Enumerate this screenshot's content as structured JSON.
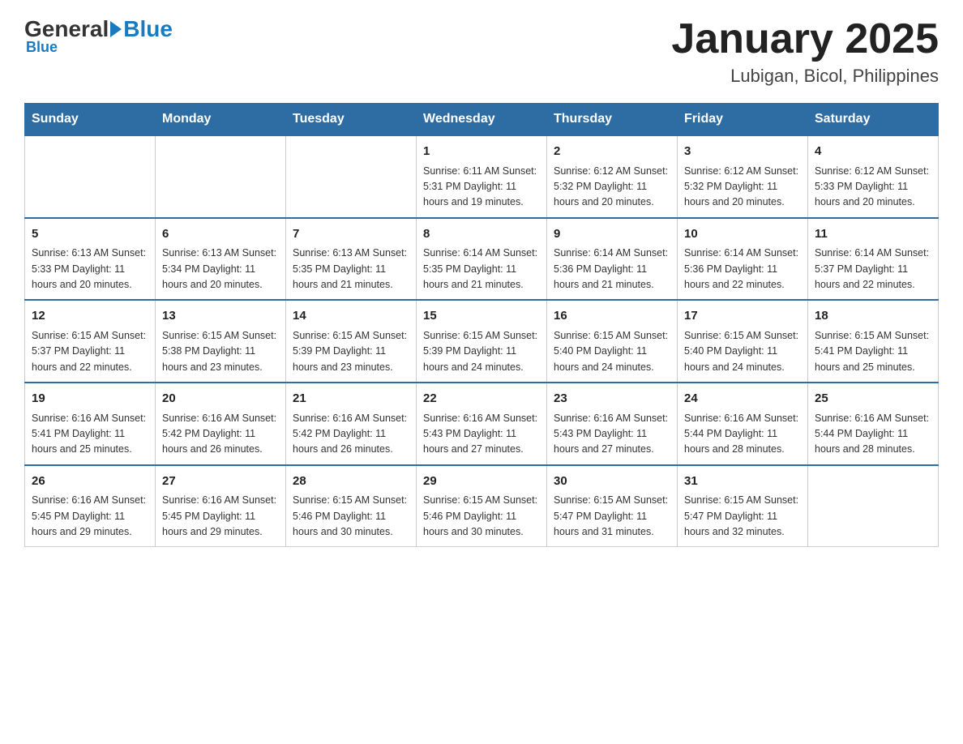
{
  "header": {
    "logo_general": "General",
    "logo_blue": "Blue",
    "month_title": "January 2025",
    "location": "Lubigan, Bicol, Philippines"
  },
  "days_of_week": [
    "Sunday",
    "Monday",
    "Tuesday",
    "Wednesday",
    "Thursday",
    "Friday",
    "Saturday"
  ],
  "weeks": [
    [
      {
        "day": "",
        "info": ""
      },
      {
        "day": "",
        "info": ""
      },
      {
        "day": "",
        "info": ""
      },
      {
        "day": "1",
        "info": "Sunrise: 6:11 AM\nSunset: 5:31 PM\nDaylight: 11 hours\nand 19 minutes."
      },
      {
        "day": "2",
        "info": "Sunrise: 6:12 AM\nSunset: 5:32 PM\nDaylight: 11 hours\nand 20 minutes."
      },
      {
        "day": "3",
        "info": "Sunrise: 6:12 AM\nSunset: 5:32 PM\nDaylight: 11 hours\nand 20 minutes."
      },
      {
        "day": "4",
        "info": "Sunrise: 6:12 AM\nSunset: 5:33 PM\nDaylight: 11 hours\nand 20 minutes."
      }
    ],
    [
      {
        "day": "5",
        "info": "Sunrise: 6:13 AM\nSunset: 5:33 PM\nDaylight: 11 hours\nand 20 minutes."
      },
      {
        "day": "6",
        "info": "Sunrise: 6:13 AM\nSunset: 5:34 PM\nDaylight: 11 hours\nand 20 minutes."
      },
      {
        "day": "7",
        "info": "Sunrise: 6:13 AM\nSunset: 5:35 PM\nDaylight: 11 hours\nand 21 minutes."
      },
      {
        "day": "8",
        "info": "Sunrise: 6:14 AM\nSunset: 5:35 PM\nDaylight: 11 hours\nand 21 minutes."
      },
      {
        "day": "9",
        "info": "Sunrise: 6:14 AM\nSunset: 5:36 PM\nDaylight: 11 hours\nand 21 minutes."
      },
      {
        "day": "10",
        "info": "Sunrise: 6:14 AM\nSunset: 5:36 PM\nDaylight: 11 hours\nand 22 minutes."
      },
      {
        "day": "11",
        "info": "Sunrise: 6:14 AM\nSunset: 5:37 PM\nDaylight: 11 hours\nand 22 minutes."
      }
    ],
    [
      {
        "day": "12",
        "info": "Sunrise: 6:15 AM\nSunset: 5:37 PM\nDaylight: 11 hours\nand 22 minutes."
      },
      {
        "day": "13",
        "info": "Sunrise: 6:15 AM\nSunset: 5:38 PM\nDaylight: 11 hours\nand 23 minutes."
      },
      {
        "day": "14",
        "info": "Sunrise: 6:15 AM\nSunset: 5:39 PM\nDaylight: 11 hours\nand 23 minutes."
      },
      {
        "day": "15",
        "info": "Sunrise: 6:15 AM\nSunset: 5:39 PM\nDaylight: 11 hours\nand 24 minutes."
      },
      {
        "day": "16",
        "info": "Sunrise: 6:15 AM\nSunset: 5:40 PM\nDaylight: 11 hours\nand 24 minutes."
      },
      {
        "day": "17",
        "info": "Sunrise: 6:15 AM\nSunset: 5:40 PM\nDaylight: 11 hours\nand 24 minutes."
      },
      {
        "day": "18",
        "info": "Sunrise: 6:15 AM\nSunset: 5:41 PM\nDaylight: 11 hours\nand 25 minutes."
      }
    ],
    [
      {
        "day": "19",
        "info": "Sunrise: 6:16 AM\nSunset: 5:41 PM\nDaylight: 11 hours\nand 25 minutes."
      },
      {
        "day": "20",
        "info": "Sunrise: 6:16 AM\nSunset: 5:42 PM\nDaylight: 11 hours\nand 26 minutes."
      },
      {
        "day": "21",
        "info": "Sunrise: 6:16 AM\nSunset: 5:42 PM\nDaylight: 11 hours\nand 26 minutes."
      },
      {
        "day": "22",
        "info": "Sunrise: 6:16 AM\nSunset: 5:43 PM\nDaylight: 11 hours\nand 27 minutes."
      },
      {
        "day": "23",
        "info": "Sunrise: 6:16 AM\nSunset: 5:43 PM\nDaylight: 11 hours\nand 27 minutes."
      },
      {
        "day": "24",
        "info": "Sunrise: 6:16 AM\nSunset: 5:44 PM\nDaylight: 11 hours\nand 28 minutes."
      },
      {
        "day": "25",
        "info": "Sunrise: 6:16 AM\nSunset: 5:44 PM\nDaylight: 11 hours\nand 28 minutes."
      }
    ],
    [
      {
        "day": "26",
        "info": "Sunrise: 6:16 AM\nSunset: 5:45 PM\nDaylight: 11 hours\nand 29 minutes."
      },
      {
        "day": "27",
        "info": "Sunrise: 6:16 AM\nSunset: 5:45 PM\nDaylight: 11 hours\nand 29 minutes."
      },
      {
        "day": "28",
        "info": "Sunrise: 6:15 AM\nSunset: 5:46 PM\nDaylight: 11 hours\nand 30 minutes."
      },
      {
        "day": "29",
        "info": "Sunrise: 6:15 AM\nSunset: 5:46 PM\nDaylight: 11 hours\nand 30 minutes."
      },
      {
        "day": "30",
        "info": "Sunrise: 6:15 AM\nSunset: 5:47 PM\nDaylight: 11 hours\nand 31 minutes."
      },
      {
        "day": "31",
        "info": "Sunrise: 6:15 AM\nSunset: 5:47 PM\nDaylight: 11 hours\nand 32 minutes."
      },
      {
        "day": "",
        "info": ""
      }
    ]
  ]
}
